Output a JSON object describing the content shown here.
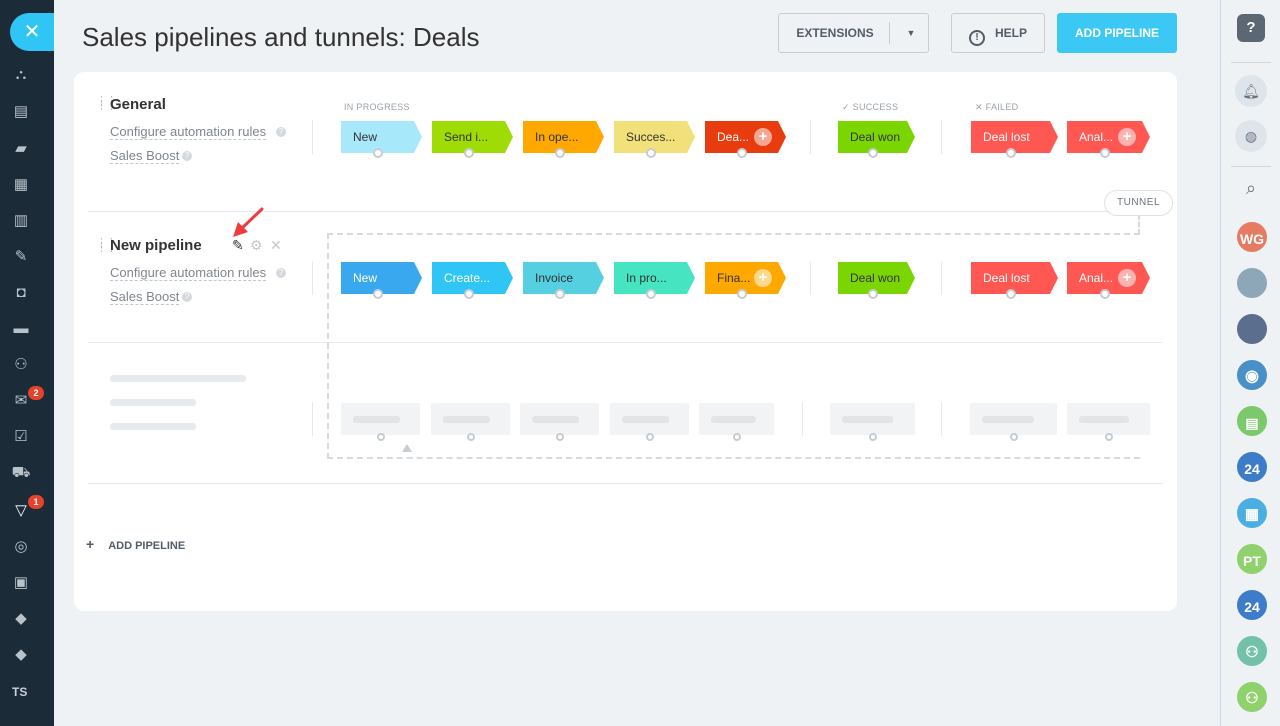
{
  "header": {
    "title": "Sales pipelines and tunnels: Deals",
    "extensions_label": "EXTENSIONS",
    "help_label": "HELP",
    "add_pipeline_label": "ADD PIPELINE"
  },
  "groups": {
    "in_progress": "IN PROGRESS",
    "success": "SUCCESS",
    "failed": "FAILED"
  },
  "pipelines": [
    {
      "name": "General",
      "automation_label": "Configure automation rules",
      "boost_label": "Sales Boost",
      "stages": [
        "New",
        "Send i...",
        "In ope...",
        "Succes...",
        "Dea..."
      ],
      "success_stage": "Deal won",
      "failed_stages": [
        "Deal lost",
        "Anal..."
      ]
    },
    {
      "name": "New pipeline",
      "automation_label": "Configure automation rules",
      "boost_label": "Sales Boost",
      "stages": [
        "New",
        "Create...",
        "Invoice",
        "In pro...",
        "Fina..."
      ],
      "success_stage": "Deal won",
      "failed_stages": [
        "Deal lost",
        "Anal..."
      ]
    }
  ],
  "tunnel_label": "TUNNEL",
  "add_pipeline_link": "ADD PIPELINE",
  "left_sidebar": {
    "mail_badge": "2",
    "pipeline_badge": "1",
    "user_initials": "TS"
  },
  "right_sidebar": {
    "avatars": [
      "WG",
      "PT"
    ],
    "bitrix_label": "24"
  },
  "colors": {
    "accent": "#3bc8f5",
    "sidebar": "#1c2b38"
  }
}
